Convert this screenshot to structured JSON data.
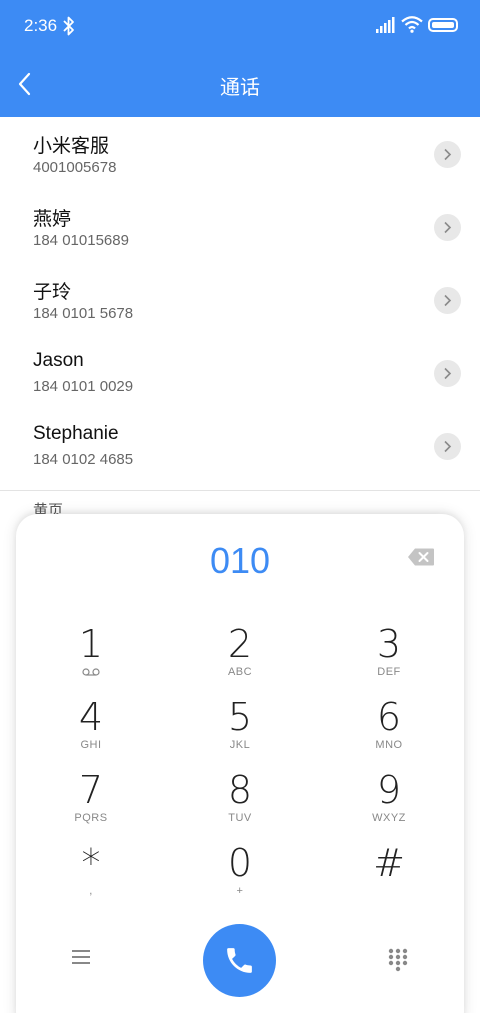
{
  "status": {
    "time": "2:36"
  },
  "header": {
    "title": "通话"
  },
  "contacts": [
    {
      "name": "小米客服",
      "number": "4001005678"
    },
    {
      "name": "燕婷",
      "number": "184 01015689"
    },
    {
      "name": "子玲",
      "number": "184 0101 5678"
    },
    {
      "name": "Jason",
      "number": "184 0101 0029"
    },
    {
      "name": "Stephanie",
      "number": "184 0102 4685"
    }
  ],
  "section": {
    "label": "黄页"
  },
  "dialpad": {
    "entry": "010",
    "keys": [
      {
        "digit": "1",
        "letters": ""
      },
      {
        "digit": "2",
        "letters": "ABC"
      },
      {
        "digit": "3",
        "letters": "DEF"
      },
      {
        "digit": "4",
        "letters": "GHI"
      },
      {
        "digit": "5",
        "letters": "JKL"
      },
      {
        "digit": "6",
        "letters": "MNO"
      },
      {
        "digit": "7",
        "letters": "PQRS"
      },
      {
        "digit": "8",
        "letters": "TUV"
      },
      {
        "digit": "9",
        "letters": "WXYZ"
      },
      {
        "digit": "*",
        "letters": ","
      },
      {
        "digit": "0",
        "letters": "+"
      },
      {
        "digit": "#",
        "letters": ""
      }
    ]
  },
  "icons": [
    "bluetooth-icon",
    "signal-icon",
    "wifi-icon",
    "battery-icon",
    "back-arrow-icon",
    "chevron-right-icon",
    "backspace-icon",
    "voicemail-icon",
    "menu-icon",
    "phone-icon",
    "dialpad-grid-icon"
  ],
  "colors": {
    "accent": "#3d8bf4",
    "background": "#ffffff"
  }
}
